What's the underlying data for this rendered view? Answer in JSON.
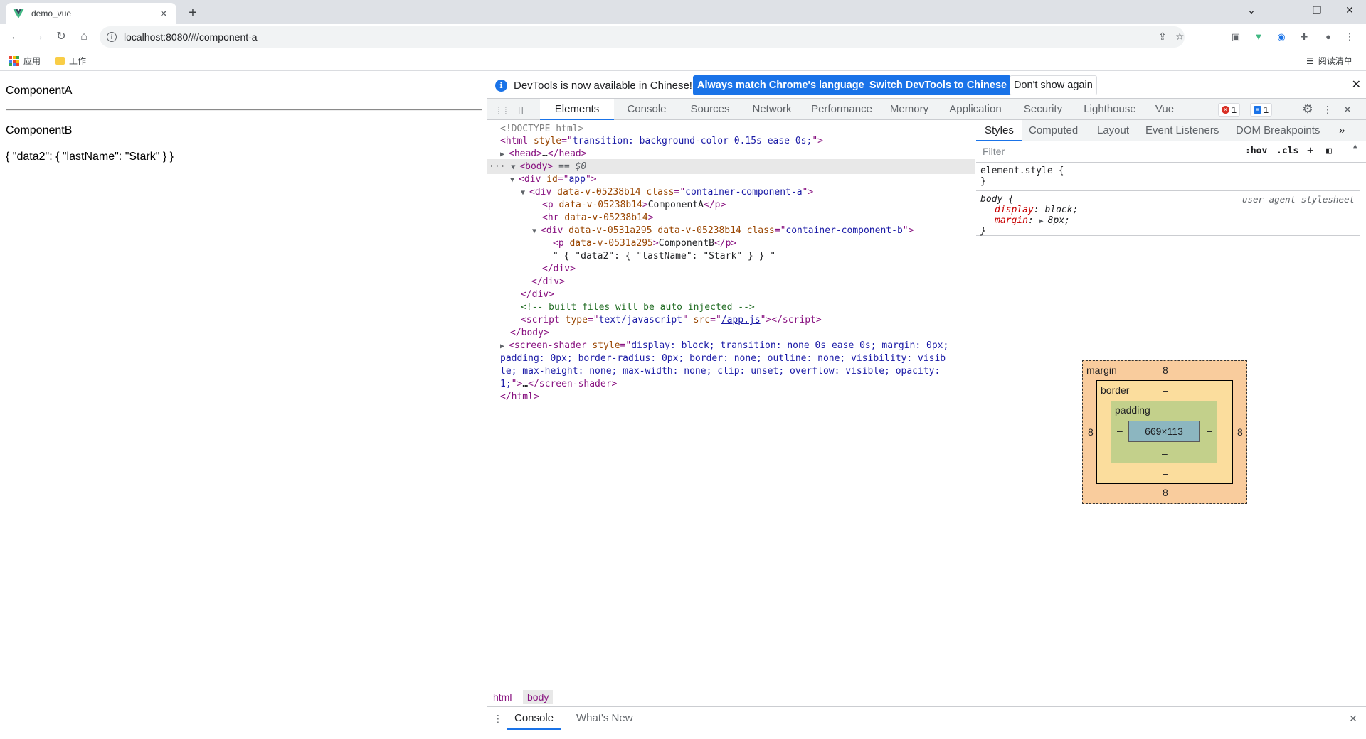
{
  "browser": {
    "tab": {
      "title": "demo_vue"
    },
    "url": "localhost:8080/#/component-a",
    "bookmarks": [
      {
        "label": "应用"
      },
      {
        "label": "工作"
      }
    ],
    "reading_list": "阅读清单"
  },
  "page": {
    "component_a": "ComponentA",
    "component_b": "ComponentB",
    "json_text": "{ \"data2\": { \"lastName\": \"Stark\" } }"
  },
  "devtools": {
    "infobar": {
      "message": "DevTools is now available in Chinese!",
      "btn_match": "Always match Chrome's language",
      "btn_switch": "Switch DevTools to Chinese",
      "btn_dismiss": "Don't show again"
    },
    "tabs": [
      "Elements",
      "Console",
      "Sources",
      "Network",
      "Performance",
      "Memory",
      "Application",
      "Security",
      "Lighthouse",
      "Vue"
    ],
    "error_count": "1",
    "message_count": "1",
    "dom": {
      "doctype": "<!DOCTYPE html>",
      "html_style": "transition: background-color 0.15s ease 0s;",
      "head_collapsed": "…",
      "body_eq": "== $0",
      "app_id": "app",
      "scope_a": "data-v-05238b14",
      "scope_b": "data-v-0531a295",
      "class_a": "container-component-a",
      "class_b": "container-component-b",
      "p_a_text": "ComponentA",
      "p_b_text": "ComponentB",
      "text_node": "\" { \"data2\": { \"lastName\": \"Stark\" } } \"",
      "comment": "<!-- built files will be auto injected -->",
      "script_type": "text/javascript",
      "script_src": "/app.js",
      "shader_style_1": "display: block; transition: none 0s ease 0s; margin: 0px;",
      "shader_style_2": "padding: 0px; border-radius: 0px; border: none; outline: none; visibility: visib",
      "shader_style_3": "le; max-height: none; max-width: none; clip: unset; overflow: visible; opacity:",
      "shader_style_4": "1;"
    },
    "breadcrumbs": [
      "html",
      "body"
    ],
    "drawer_tabs": [
      "Console",
      "What's New"
    ],
    "styles": {
      "tabs": [
        "Styles",
        "Computed",
        "Layout",
        "Event Listeners",
        "DOM Breakpoints"
      ],
      "filter_placeholder": "Filter",
      "hov": ":hov",
      "cls": ".cls",
      "element_style": "element.style {",
      "body_selector": "body {",
      "ua_label": "user agent stylesheet",
      "prop_display": "display",
      "val_display": "block;",
      "prop_margin": "margin",
      "val_margin": "8px;",
      "close_brace": "}"
    },
    "boxmodel": {
      "margin_label": "margin",
      "border_label": "border",
      "padding_label": "padding",
      "margin": "8",
      "dash": "–",
      "content_size": "669×113"
    }
  }
}
